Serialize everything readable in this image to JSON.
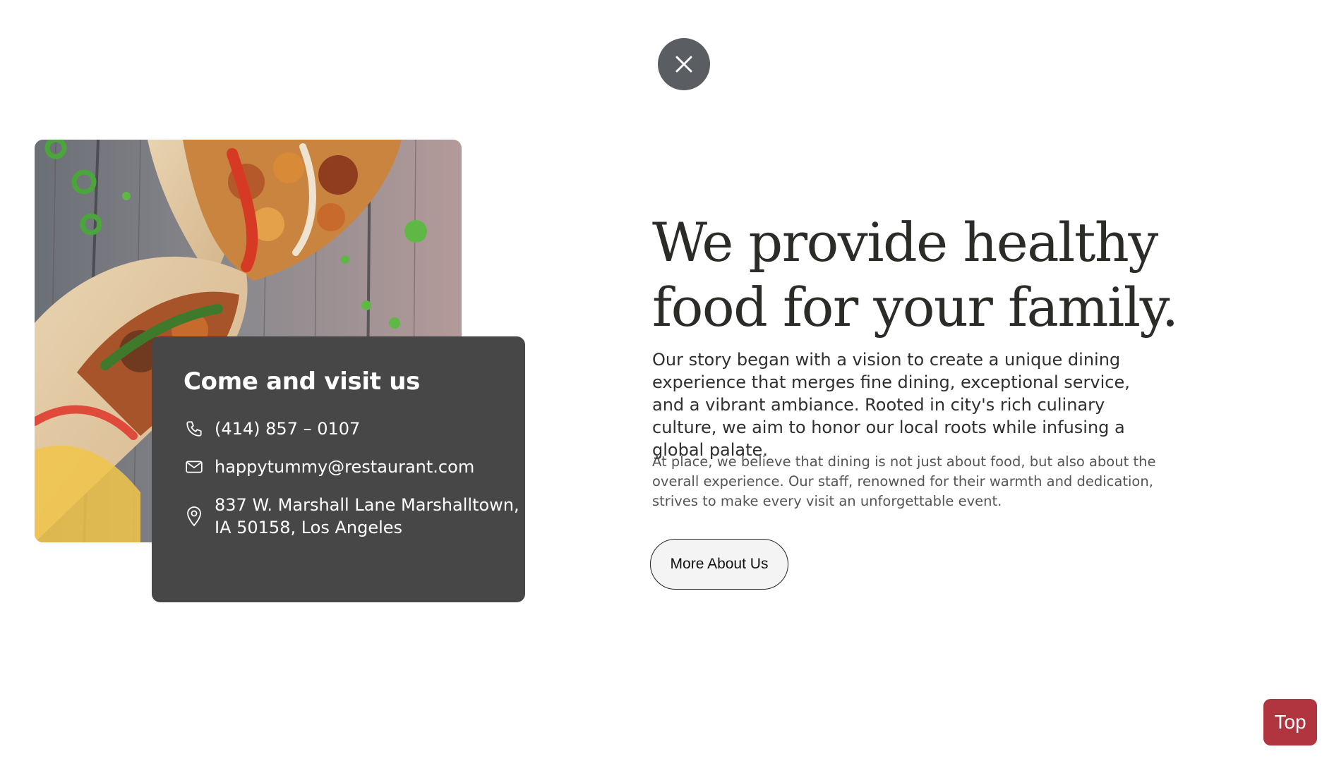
{
  "modal": {
    "close_icon": "close-icon"
  },
  "visit_card": {
    "title": "Come and visit us",
    "phone": "(414) 857 – 0107",
    "email": "happytummy@restaurant.com",
    "address_line1": "837 W. Marshall Lane Marshalltown,",
    "address_line2": "IA 50158, Los Angeles",
    "icons": [
      "phone-icon",
      "mail-icon",
      "location-pin-icon"
    ]
  },
  "about": {
    "headline_line1": "We provide healthy",
    "headline_line2": "food for your family.",
    "lead": "Our story began with a vision to create a unique dining experience that merges fine dining, exceptional service, and a vibrant ambiance. Rooted in city's rich culinary culture, we aim to honor our local roots while infusing a global palate.",
    "sub": "At place, we believe that dining is not just about food, but also about the overall experience. Our staff, renowned for their warmth and dedication, strives to make every visit an unforgettable event.",
    "button_label": "More About Us"
  },
  "scroll_top": {
    "label": "Top"
  },
  "colors": {
    "card_bg": "#474747",
    "close_bg": "#5a5d61",
    "top_button_bg": "#b0353f",
    "headline": "#2b2b28"
  }
}
